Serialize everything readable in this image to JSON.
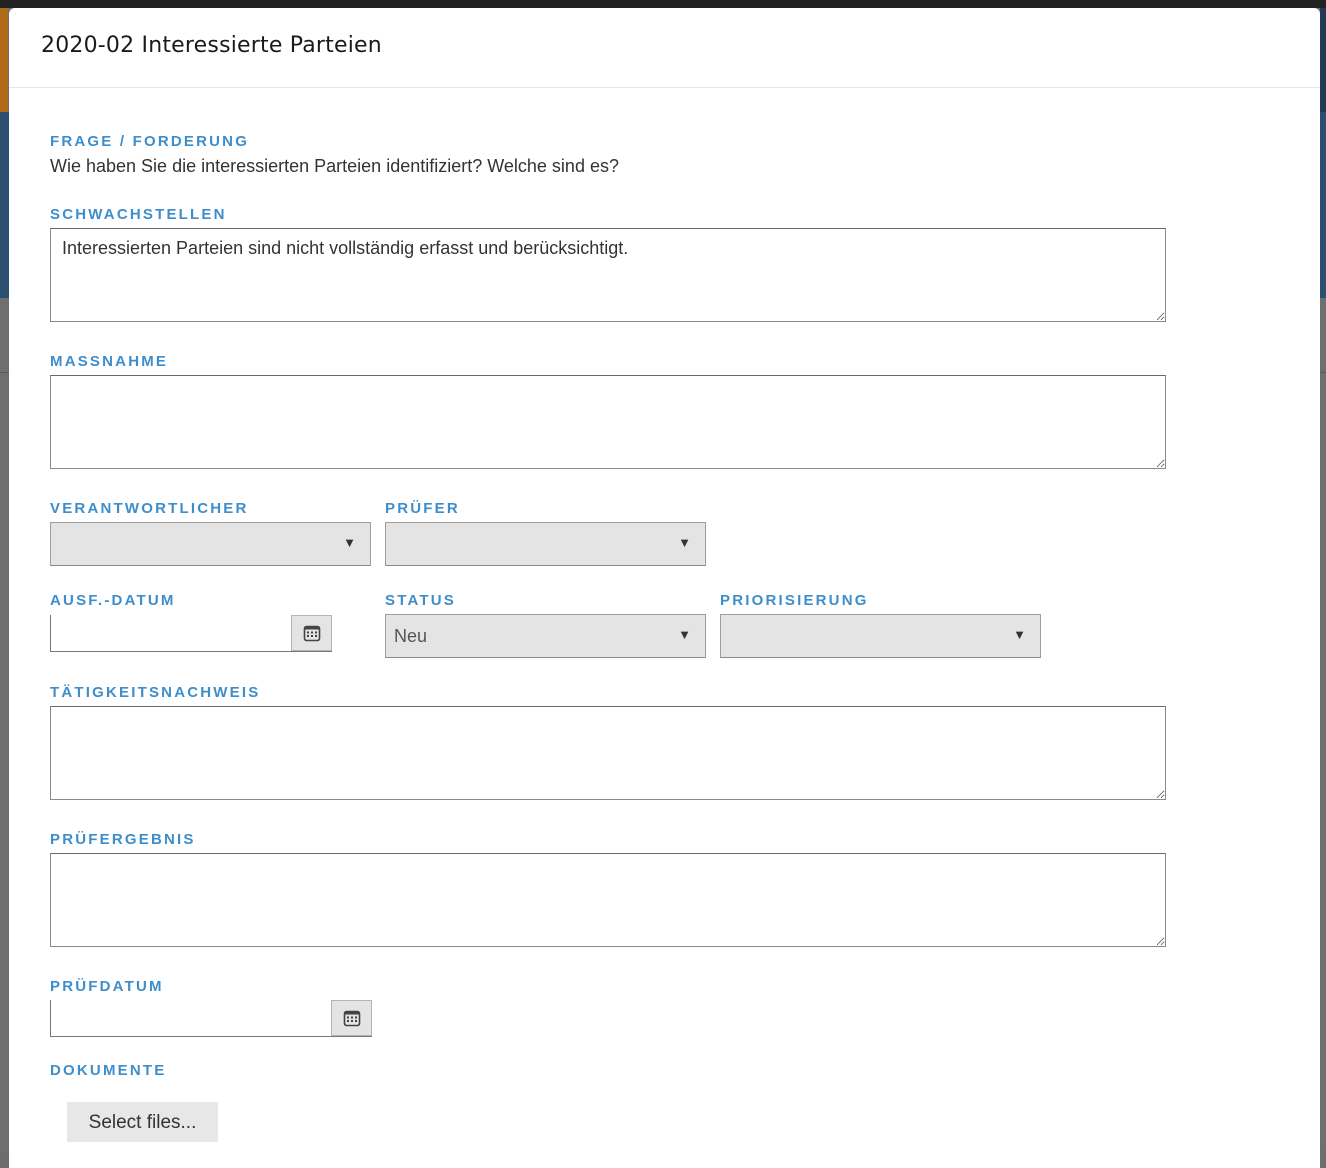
{
  "modal": {
    "title": "2020-02 Interessierte Parteien"
  },
  "form": {
    "frage_label": "FRAGE / FORDERUNG",
    "frage_text": "Wie haben Sie die interessierten Parteien identifiziert? Welche sind es?",
    "schwachstellen_label": "SCHWACHSTELLEN",
    "schwachstellen_value": "Interessierten Parteien sind nicht vollständig erfasst und berücksichtigt.",
    "massnahme_label": "MASSNAHME",
    "massnahme_value": "",
    "verantwortlicher_label": "VERANTWORTLICHER",
    "verantwortlicher_value": "",
    "pruefer_label": "PRÜFER",
    "pruefer_value": "",
    "ausf_datum_label": "AUSF.-DATUM",
    "ausf_datum_value": "",
    "status_label": "STATUS",
    "status_value": "Neu",
    "priorisierung_label": "PRIORISIERUNG",
    "priorisierung_value": "",
    "taetigkeitsnachweis_label": "TÄTIGKEITSNACHWEIS",
    "taetigkeitsnachweis_value": "",
    "pruefergebnis_label": "PRÜFERGEBNIS",
    "pruefergebnis_value": "",
    "pruefdatum_label": "PRÜFDATUM",
    "pruefdatum_value": "",
    "dokumente_label": "DOKUMENTE",
    "select_files_label": "Select files..."
  },
  "icons": {
    "dropdown": "triangle-down-icon",
    "calendar": "calendar-icon"
  },
  "colors": {
    "label_blue": "#3d8ecb",
    "select_bg": "#e4e4e4"
  }
}
